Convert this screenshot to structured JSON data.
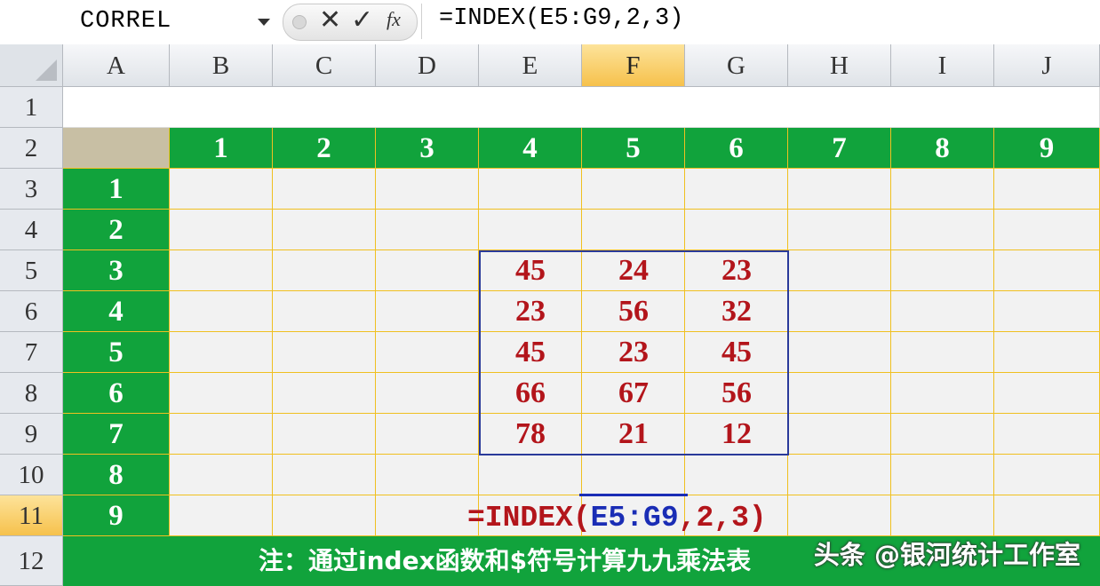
{
  "formula_bar": {
    "name_box": "CORREL",
    "formula": "=INDEX(E5:G9,2,3)",
    "cancel_icon": "close-icon",
    "enter_icon": "check-icon",
    "fx_label": "fx"
  },
  "columns": [
    "A",
    "B",
    "C",
    "D",
    "E",
    "F",
    "G",
    "H",
    "I",
    "J"
  ],
  "selected_column": "F",
  "rows": [
    "1",
    "2",
    "3",
    "4",
    "5",
    "6",
    "7",
    "8",
    "9",
    "10",
    "11",
    "12"
  ],
  "selected_row": "11",
  "top_header_numbers": [
    "1",
    "2",
    "3",
    "4",
    "5",
    "6",
    "7",
    "8",
    "9"
  ],
  "left_header_numbers": [
    "1",
    "2",
    "3",
    "4",
    "5",
    "6",
    "7",
    "8",
    "9"
  ],
  "matrix": [
    [
      "45",
      "24",
      "23"
    ],
    [
      "23",
      "56",
      "32"
    ],
    [
      "45",
      "23",
      "45"
    ],
    [
      "66",
      "67",
      "56"
    ],
    [
      "78",
      "21",
      "12"
    ]
  ],
  "cell_formula": {
    "prefix": "=INDEX(",
    "ref": "E5:G9",
    "suffix": ",2,3)"
  },
  "note": "注：通过index函数和$符号计算九九乘法表",
  "watermark": "头条 @银河统计工作室",
  "colors": {
    "green": "#11a33c",
    "grid_line": "#f0c020",
    "value_red": "#b3151b",
    "ref_blue": "#1a2db5",
    "selected_header": "#f6c14c"
  }
}
